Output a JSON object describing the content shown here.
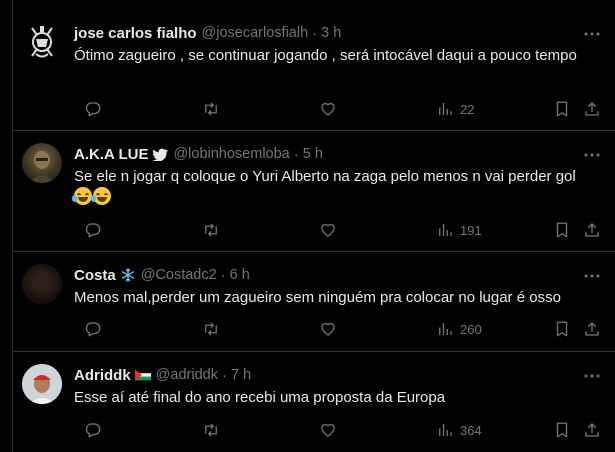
{
  "tweets": [
    {
      "name": "jose carlos fialho",
      "handle": "@josecarlosfialh",
      "time": "3 h",
      "text": "Ótimo zagueiro , se continuar jogando , será intocável daqui a pouco tempo",
      "views": "22",
      "avatar_icon": "team-crest-icon"
    },
    {
      "name": "A.K.A LUE",
      "badge_icon": "bird-icon",
      "handle": "@lobinhosemloba",
      "time": "5 h",
      "text": "Se ele n jogar q coloque o Yuri Alberto na zaga pelo menos n vai perder gol",
      "emojis": [
        "crying-laughing-emoji",
        "crying-laughing-emoji"
      ],
      "views": "191",
      "avatar_icon": "user-photo"
    },
    {
      "name": "Costa",
      "badge_icon": "snowflake-icon",
      "handle": "@Costadc2",
      "time": "6 h",
      "text": "Menos mal,perder um zagueiro sem ninguém pra colocar no lugar é osso",
      "views": "260",
      "avatar_icon": "user-photo-dark"
    },
    {
      "name": "Adriddk",
      "badge_icon": "palestine-flag-icon",
      "handle": "@adriddk",
      "time": "7 h",
      "text": "Esse aí até final do ano recebi uma proposta da Europa",
      "views": "364",
      "avatar_icon": "user-photo-red-cap"
    }
  ],
  "separator": "·",
  "colors": {
    "background": "#000000",
    "text": "#e7e9ea",
    "muted": "#71767b",
    "border": "#2f3336",
    "verified_blue": "#1d9bf0"
  }
}
